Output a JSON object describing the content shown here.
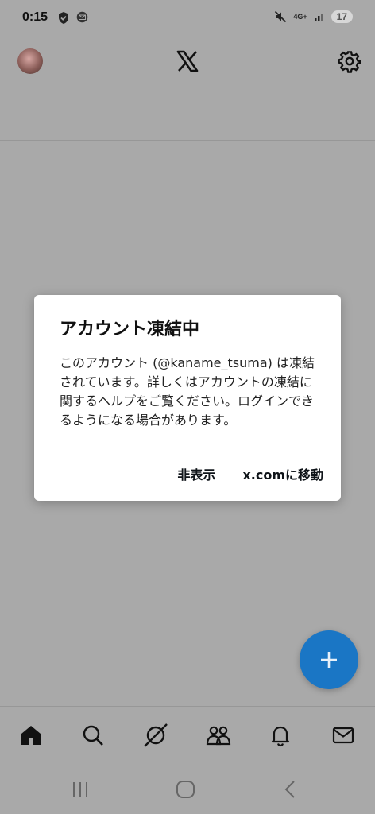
{
  "status_bar": {
    "time": "0:15",
    "battery": "17",
    "network": "4G+",
    "icons": [
      "shield-check-icon",
      "mail-icon",
      "mute-icon",
      "signal-icon"
    ]
  },
  "header": {
    "logo": "x-logo-icon",
    "settings_icon": "gear-icon",
    "avatar": "profile-avatar"
  },
  "dialog": {
    "title": "アカウント凍結中",
    "body": "このアカウント (@kaname_tsuma) は凍結されています。詳しくはアカウントの凍結に関するヘルプをご覧ください。ログインできるようになる場合があります。",
    "dismiss_label": "非表示",
    "goto_label": "x.comに移動"
  },
  "fab": {
    "icon": "plus-icon",
    "color": "#1a76c5"
  },
  "bottom_nav": {
    "items": [
      "home-icon",
      "search-icon",
      "grok-icon",
      "communities-icon",
      "notifications-icon",
      "messages-icon"
    ]
  },
  "system_nav": {
    "items": [
      "recent-apps-icon",
      "home-button-icon",
      "back-icon"
    ]
  },
  "colors": {
    "overlay_bg": "#a9a9a9",
    "dialog_bg": "#ffffff",
    "accent": "#1a76c5"
  }
}
